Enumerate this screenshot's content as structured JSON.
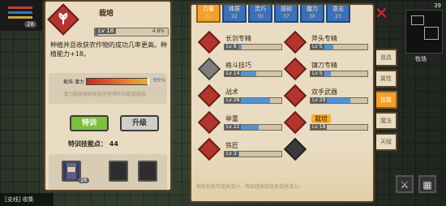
{
  "hud": {
    "level": "28",
    "chat_channel": "[支线] 收集"
  },
  "top_right": {
    "status": "39",
    "location": "牧场"
  },
  "detail": {
    "skill_name": "栽培",
    "lv_text": "Lv 18",
    "lv_fill_pct": 0.048,
    "lv_pct_text": "4.8%",
    "description": "种植并且收获农作物的成功几率更高。种植能力+18。",
    "potential_label": "栽培 潜力",
    "potential_value": 0.99,
    "potential_pct": "99%",
    "potential_hint": "潜力越高锻炼技能时获得的训练度越高",
    "train_button": "特训",
    "upgrade_button": "升级",
    "train_points_label": "特训技能点：",
    "train_points_value": "44",
    "hero_level": "28"
  },
  "tabs": [
    {
      "label": "力量",
      "value": "33",
      "active": true
    },
    {
      "label": "体质",
      "value": "22",
      "active": false
    },
    {
      "label": "灵巧",
      "value": "30",
      "active": false
    },
    {
      "label": "感知",
      "value": "37",
      "active": false
    },
    {
      "label": "魔力",
      "value": "30",
      "active": false
    },
    {
      "label": "意志",
      "value": "23",
      "active": false
    }
  ],
  "skills": [
    {
      "name": "长剑专精",
      "lv": "Lv 8",
      "fill": 0.3,
      "icon": "sword-icon",
      "style": "red"
    },
    {
      "name": "斧头专精",
      "lv": "Lv 5",
      "fill": 0.4,
      "icon": "axe-icon",
      "style": "red"
    },
    {
      "name": "格斗技巧",
      "lv": "Lv 14",
      "fill": 0.55,
      "icon": "fist-icon",
      "style": "gray"
    },
    {
      "name": "镰刀专精",
      "lv": "Lv 5",
      "fill": 0.35,
      "icon": "scythe-icon",
      "style": "red"
    },
    {
      "name": "战术",
      "lv": "Lv 28",
      "fill": 0.8,
      "icon": "tactics-icon",
      "style": "red"
    },
    {
      "name": "双手武器",
      "lv": "Lv 29",
      "fill": 0.7,
      "icon": "two-hand-icon",
      "style": "red"
    },
    {
      "name": "举重",
      "lv": "Lv 22",
      "fill": 0.6,
      "icon": "dumbbell-icon",
      "style": "red"
    },
    {
      "name": "栽培",
      "lv": "Lv 18",
      "fill": 0.05,
      "icon": "plant-icon",
      "style": "red",
      "selected": true
    },
    {
      "name": "铁匠",
      "lv": "Lv 3",
      "fill": 0.25,
      "icon": "anvil-icon",
      "style": "red"
    }
  ],
  "hint_text": "锻炼技能可提高潜力，等级越高越容易提高潜力。",
  "side_tabs": [
    {
      "label": "道具",
      "active": false
    },
    {
      "label": "属性",
      "active": false
    },
    {
      "label": "技能",
      "active": true
    },
    {
      "label": "魔法",
      "active": false
    },
    {
      "label": "天赋",
      "active": false
    }
  ],
  "colors": {
    "panel_bg": "#e9dcc2",
    "accent_orange": "#f0a030",
    "tab_blue": "#3c6fb8",
    "train_green": "#7bbf3c",
    "skill_red": "#b2362e"
  }
}
